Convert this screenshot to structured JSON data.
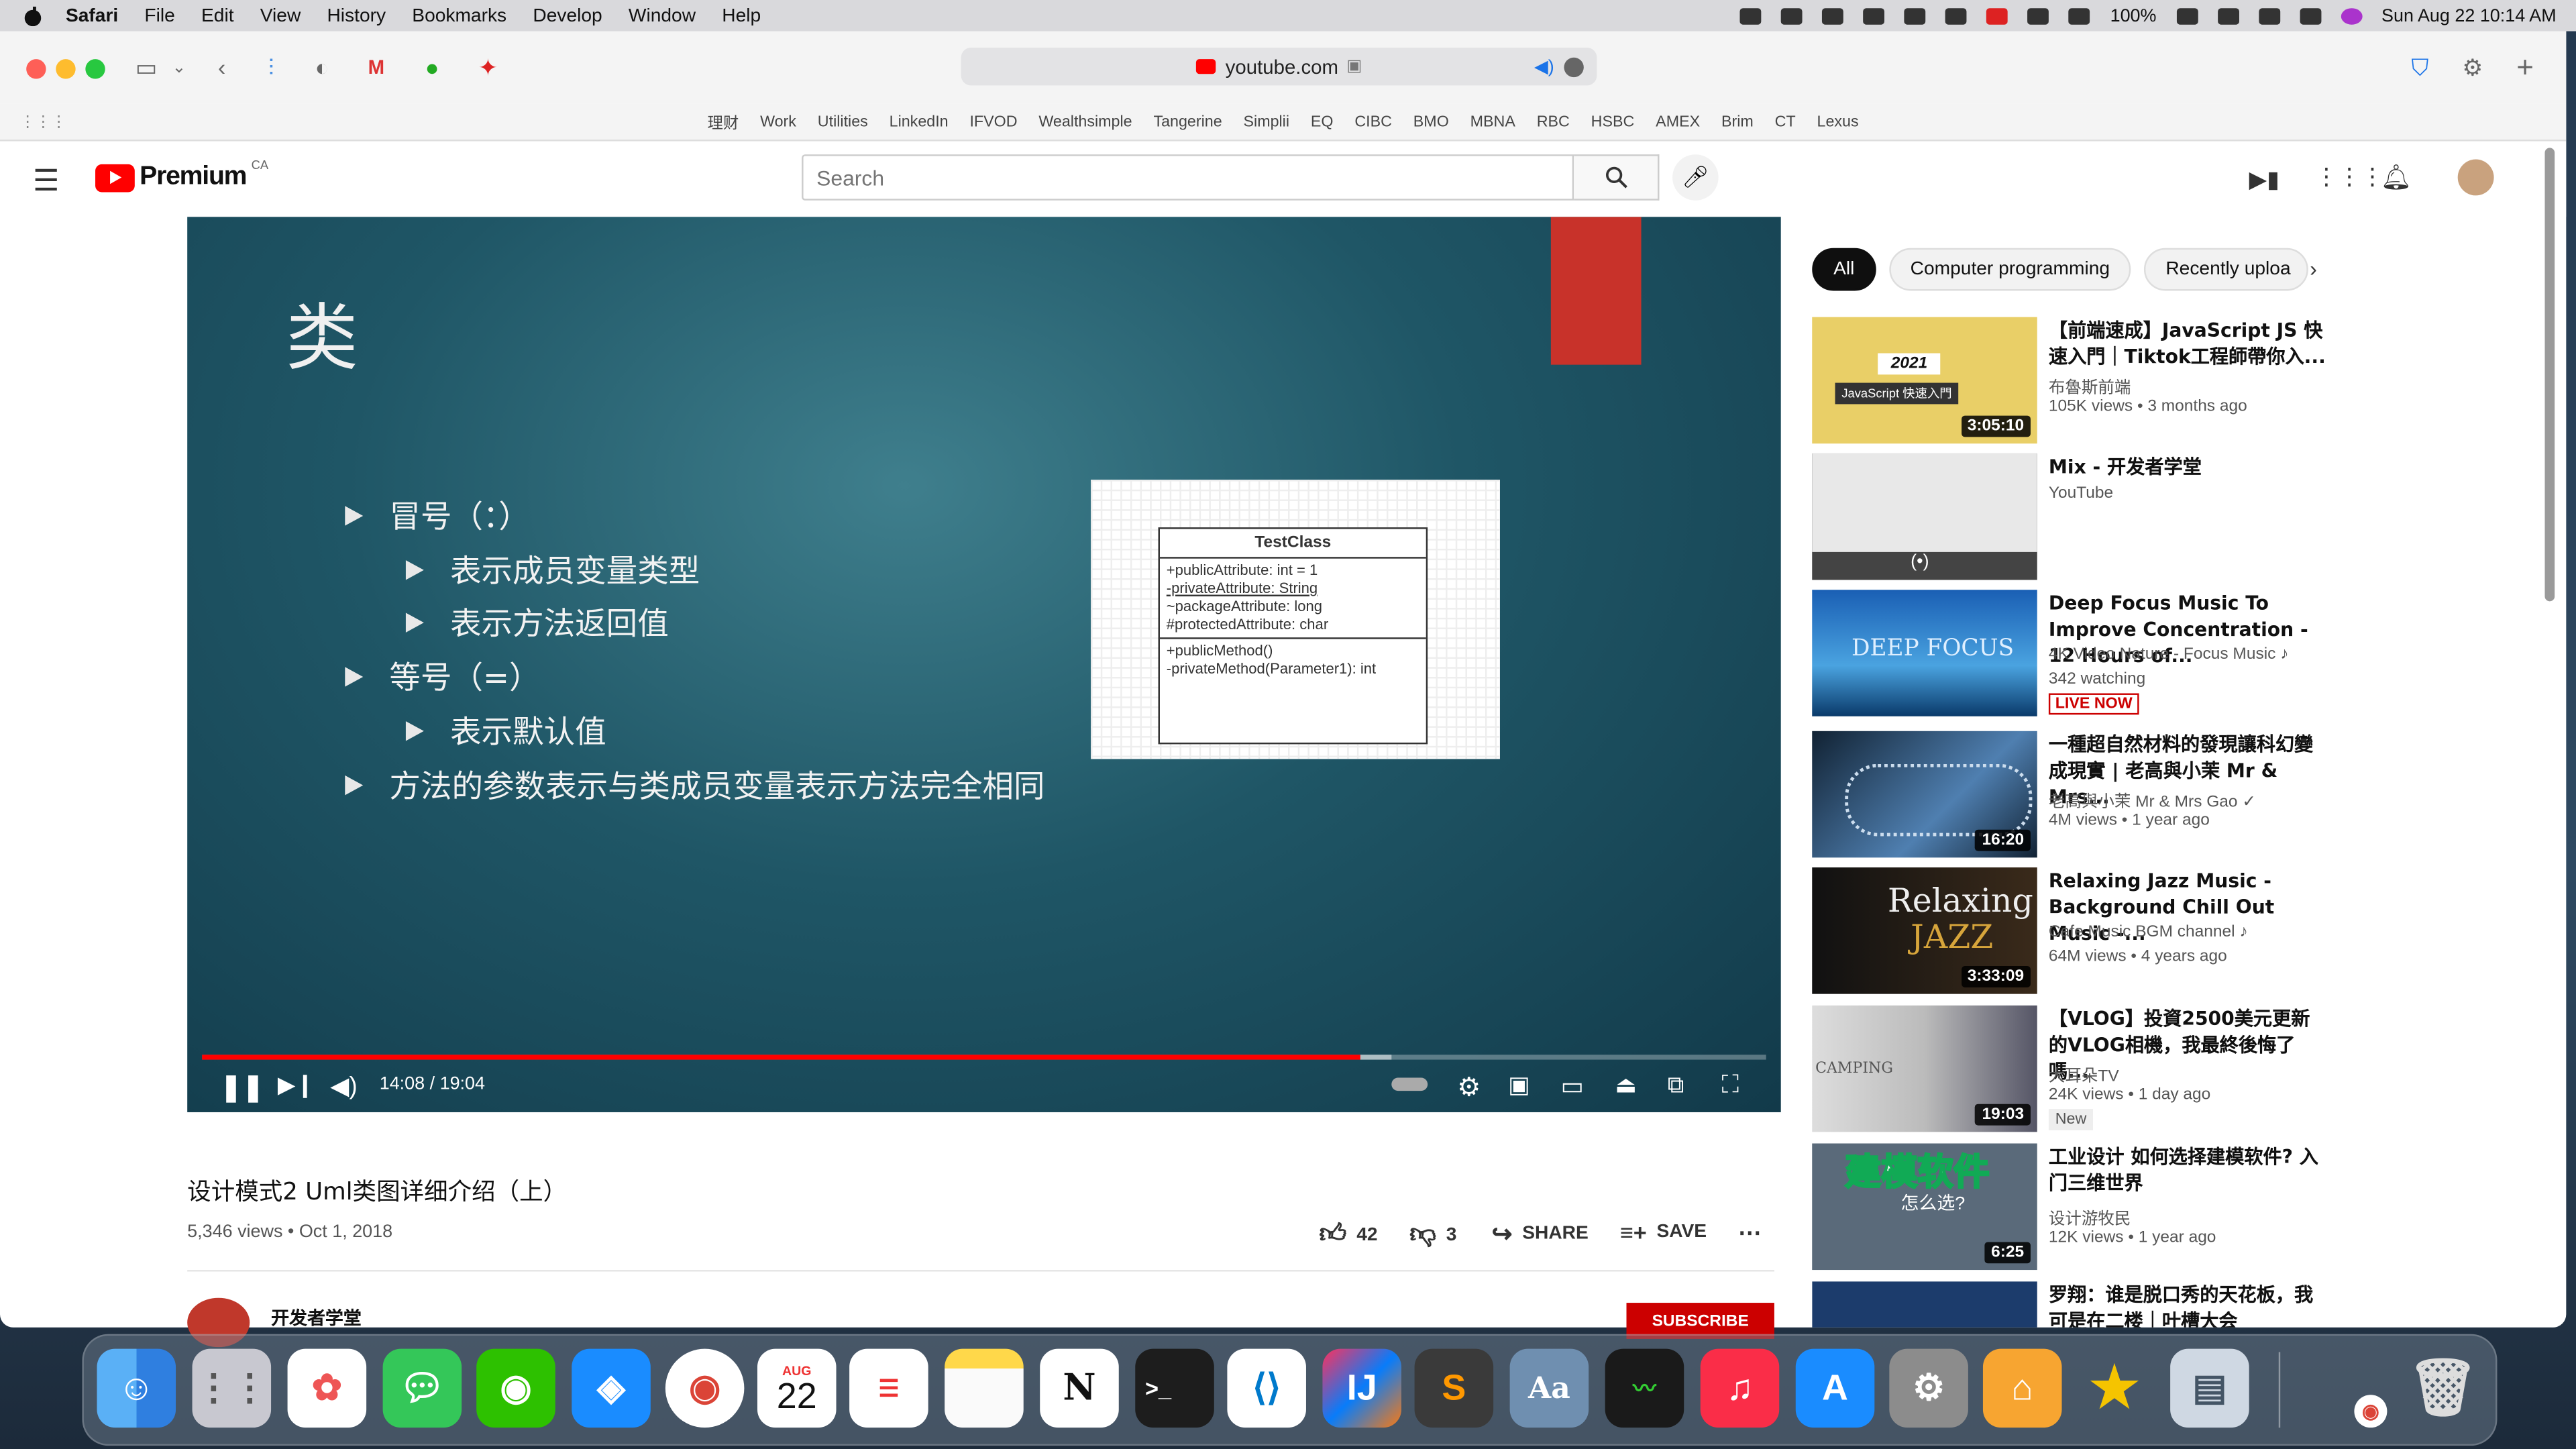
{
  "menubar": {
    "app": "Safari",
    "items": [
      "File",
      "Edit",
      "View",
      "History",
      "Bookmarks",
      "Develop",
      "Window",
      "Help"
    ],
    "battery": "100%",
    "datetime": "Sun Aug 22  10:14 AM"
  },
  "browser": {
    "url": "youtube.com",
    "bookmarks": [
      "理财",
      "Work",
      "Utilities",
      "LinkedIn",
      "IFVOD",
      "Wealthsimple",
      "Tangerine",
      "Simplii",
      "EQ",
      "CIBC",
      "BMO",
      "MBNA",
      "RBC",
      "HSBC",
      "AMEX",
      "Brim",
      "CT",
      "Lexus"
    ]
  },
  "youtube": {
    "logo_text": "Premium",
    "region": "CA",
    "search_placeholder": "Search"
  },
  "slide": {
    "title": "类",
    "bullets": [
      "冒号（：）",
      "表示成员变量类型",
      "表示方法返回值",
      "等号（=）",
      "表示默认值",
      "方法的参数表示与类成员变量表示方法完全相同"
    ],
    "uml": {
      "class_name": "TestClass",
      "attributes": [
        "+publicAttribute: int = 1",
        "-privateAttribute: String",
        "~packageAttribute: long",
        "#protectedAttribute: char"
      ],
      "methods": [
        "+publicMethod()",
        "-privateMethod(Parameter1): int"
      ]
    }
  },
  "player": {
    "time": "14:08 / 19:04",
    "progress": 0.741,
    "buffered": 0.76
  },
  "video": {
    "title": "设计模式2 Uml类图详细介绍（上）",
    "meta": "5,346 views • Oct 1, 2018",
    "likes": "42",
    "dislikes": "3",
    "share": "SHARE",
    "save": "SAVE",
    "channel": "开发者学堂",
    "subscribe": "SUBSCRIBE"
  },
  "sidebar": {
    "chips": [
      "All",
      "Computer programming",
      "Recently uploa"
    ],
    "items": [
      {
        "title": "【前端速成】JavaScript JS 快速入門｜Tiktok工程師帶你入...",
        "channel": "布魯斯前端",
        "views": "105K views • 3 months ago",
        "duration": "3:05:10",
        "thumb_text": "2021",
        "thumb_sub": "JavaScript 快速入門"
      },
      {
        "title": "Mix - 开发者学堂",
        "channel": "YouTube",
        "views": "",
        "duration": ""
      },
      {
        "title": "Deep Focus Music To Improve Concentration - 12 Hours of...",
        "channel": "4K Video Nature - Focus Music ♪",
        "views": "342 watching",
        "duration": "",
        "badge": "LIVE NOW",
        "thumb_text": "DEEP FOCUS"
      },
      {
        "title": "一種超自然材料的發現讓科幻變成現實 | 老高與小茉 Mr & Mrs...",
        "channel": "老高與小茉 Mr & Mrs Gao ✓",
        "views": "4M views • 1 year ago",
        "duration": "16:20"
      },
      {
        "title": "Relaxing Jazz Music - Background Chill Out Music -...",
        "channel": "Cafe Music BGM channel ♪",
        "views": "64M views • 4 years ago",
        "duration": "3:33:09",
        "thumb_text": "Relaxing",
        "thumb_sub": "JAZZ"
      },
      {
        "title": "【VLOG】投資2500美元更新的VLOG相機，我最終後悔了嗎...",
        "channel": "大耳朵TV",
        "views": "24K views • 1 day ago",
        "duration": "19:03",
        "badge": "New",
        "thumb_text": "CAMPING"
      },
      {
        "title": "工业设计 如何选择建模软件? 入门三维世界",
        "channel": "设计游牧民",
        "views": "12K views • 1 year ago",
        "duration": "6:25",
        "thumb_text": "建模软件",
        "thumb_sub": "怎么选?"
      },
      {
        "title": "罗翔：谁是脱口秀的天花板，我可是在二楼｜叶槽大会",
        "channel": "",
        "views": "",
        "duration": ""
      }
    ]
  },
  "dock": {
    "calendar_month": "AUG",
    "calendar_day": "22",
    "apps": [
      "finder-icon",
      "launchpad-icon",
      "photos-icon",
      "messages-icon",
      "wechat-icon",
      "safari-icon",
      "chrome-icon",
      "calendar-icon",
      "reminders-icon",
      "notes-icon",
      "notion-icon",
      "terminal-icon",
      "vscode-icon",
      "intellij-icon",
      "sublime-icon",
      "dictionary-icon",
      "activity-monitor-icon",
      "music-icon",
      "app-store-icon",
      "system-preferences-icon",
      "home-icon",
      "superstar-icon",
      "preview-icon",
      "trash-icon"
    ]
  },
  "colors": {
    "youtube_red": "#ff0000",
    "accent_blue": "#1a73e8",
    "slide_bg": "#1f5666"
  }
}
